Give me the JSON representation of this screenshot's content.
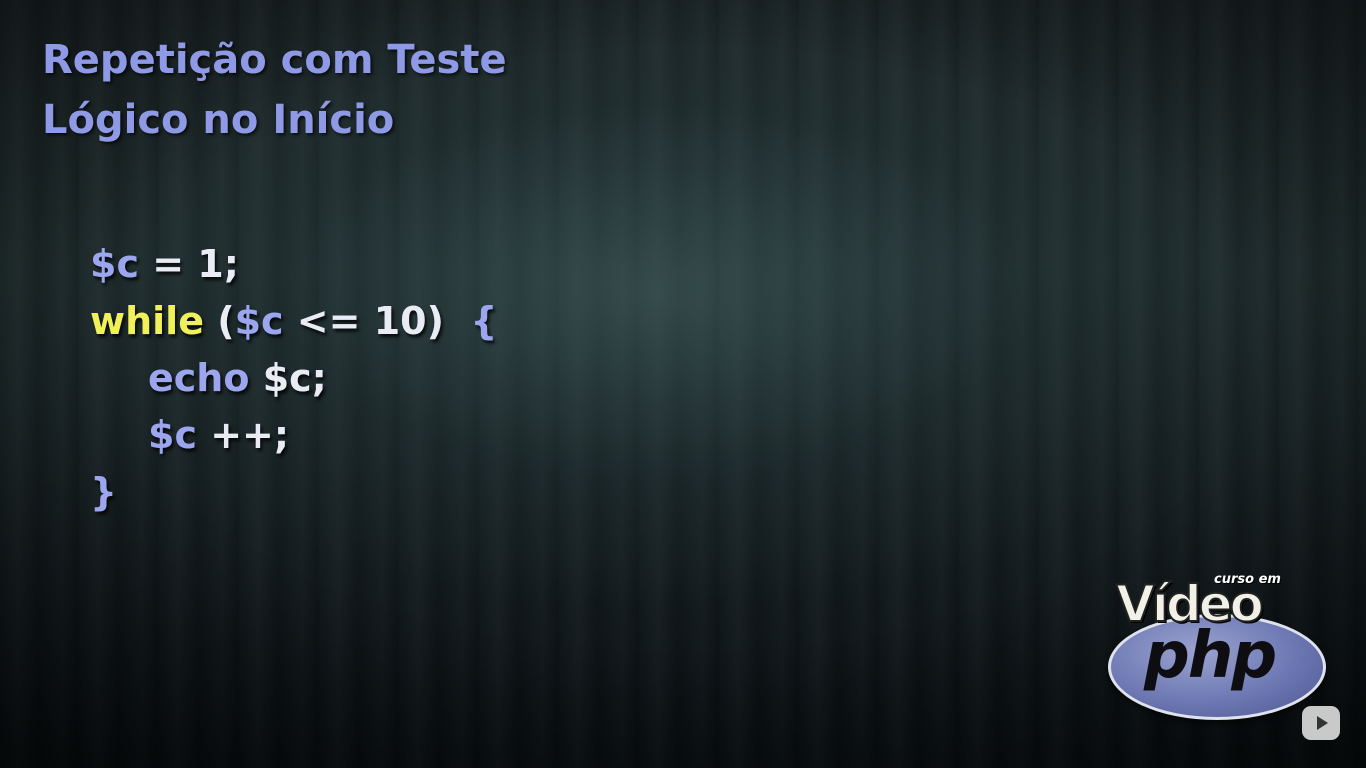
{
  "slide": {
    "title_line1": "Repetição com Teste",
    "title_line2": "Lógico no Início"
  },
  "code": {
    "line1": {
      "var": "$c",
      "rest": " = 1;"
    },
    "line2": {
      "keyword": "while",
      "open": " (",
      "var": "$c",
      "cond": " <= 10)",
      "brace": "  {"
    },
    "line3": {
      "cmd": "echo ",
      "var": "$c",
      "end": ";"
    },
    "line4": {
      "var": "$c",
      "rest": " ++;"
    },
    "line5": {
      "brace": "}"
    }
  },
  "logo": {
    "small": "curso em",
    "video": "Vídeo",
    "php": "php"
  },
  "icons": {
    "youtube": "youtube-play-icon"
  },
  "colors": {
    "title": "#8f9ae6",
    "variable": "#9ba6ee",
    "keyword": "#f0f05a",
    "plain": "#e9ecf5"
  }
}
